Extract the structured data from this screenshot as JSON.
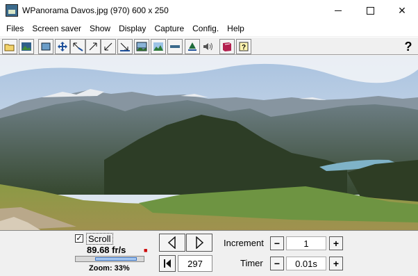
{
  "window": {
    "title": "WPanorama  Davos.jpg   (970) 600 x 250",
    "minimize": "—",
    "maximize": "☐",
    "close": "✕"
  },
  "menu": {
    "items": [
      "Files",
      "Screen saver",
      "Show",
      "Display",
      "Capture",
      "Config.",
      "Help"
    ]
  },
  "toolbar": {
    "buttons": [
      "open-folder-icon",
      "picture-icon",
      "fit-icon",
      "move-icon",
      "shrink-left-icon",
      "expand-icon",
      "shrink-down-icon",
      "stretch-down-icon",
      "view-icon",
      "landscape-icon",
      "flat-icon",
      "tree-icon",
      "sound-icon",
      "book-icon",
      "help-book-icon"
    ],
    "help_label": "?"
  },
  "controls": {
    "scroll_label": "Scroll",
    "scroll_checked": "✓",
    "fps": "89.68 fr/s",
    "zoom": "Zoom: 33%",
    "zoom_fraction": 0.33,
    "counter": "297",
    "increment_label": "Increment",
    "increment_value": "1",
    "timer_label": "Timer",
    "timer_value": "0.01s",
    "minus": "−",
    "plus": "+"
  }
}
